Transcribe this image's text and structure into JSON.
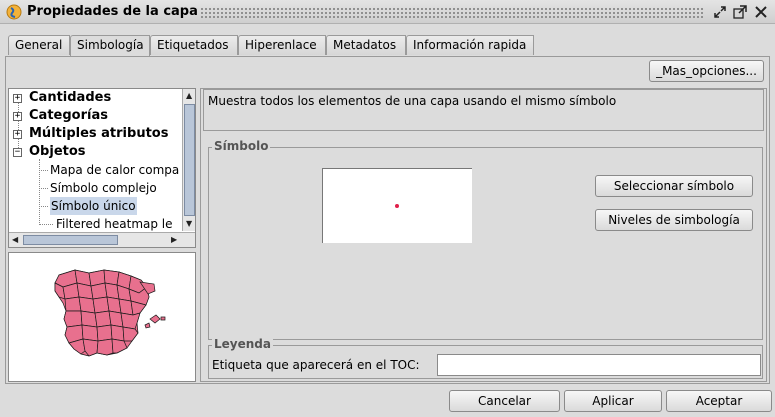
{
  "window": {
    "title": "Propiedades de la capa",
    "icons": [
      "app-icon",
      "restore-icon",
      "maximize-icon",
      "close-icon"
    ]
  },
  "tabs": [
    {
      "label": "General",
      "active": false
    },
    {
      "label": "Simbología",
      "active": true
    },
    {
      "label": "Etiquetados",
      "active": false
    },
    {
      "label": "Hiperenlace",
      "active": false
    },
    {
      "label": "Metadatos",
      "active": false
    },
    {
      "label": "Información rapida",
      "active": false
    }
  ],
  "more_options_label": "_Mas_opciones...",
  "tree": {
    "categories": [
      {
        "label": "Cantidades",
        "expanded": false
      },
      {
        "label": "Categorías",
        "expanded": false
      },
      {
        "label": "Múltiples atributos",
        "expanded": false
      },
      {
        "label": "Objetos",
        "expanded": true
      }
    ],
    "leaves": [
      {
        "label": "Mapa de calor compa"
      },
      {
        "label": "Símbolo complejo"
      },
      {
        "label": "Símbolo único",
        "selected": true
      },
      {
        "label": "Filtered heatmap le"
      }
    ]
  },
  "description": "Muestra todos los elementos de una capa usando el mismo símbolo",
  "symbol_group": {
    "title": "Símbolo",
    "select_button": "Seleccionar símbolo",
    "levels_button": "Niveles de simbología",
    "symbol_color": "#e0204a"
  },
  "legend_group": {
    "title": "Leyenda",
    "label": "Etiqueta que aparecerá en el TOC:",
    "value": ""
  },
  "footer": {
    "cancel": "Cancelar",
    "apply": "Aplicar",
    "accept": "Aceptar"
  },
  "colors": {
    "map_fill": "#e8708e",
    "selection": "#c9d7ea",
    "scroll_thumb": "#b9c6d8"
  }
}
